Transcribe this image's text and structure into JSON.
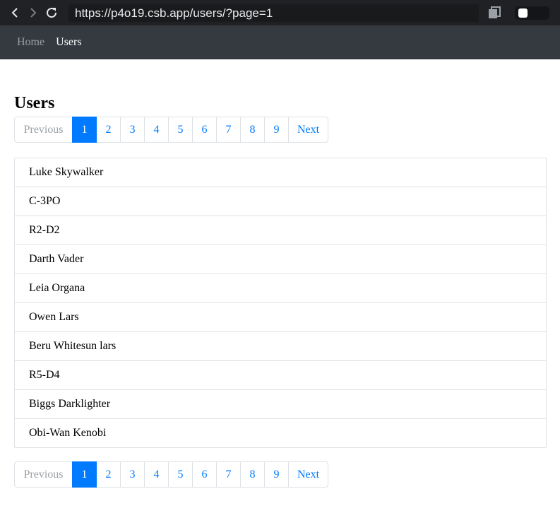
{
  "browser": {
    "url": "https://p4o19.csb.app/users/?page=1"
  },
  "navbar": {
    "items": [
      {
        "label": "Home",
        "active": false
      },
      {
        "label": "Users",
        "active": true
      }
    ]
  },
  "page": {
    "title": "Users"
  },
  "pagination": {
    "previous_label": "Previous",
    "next_label": "Next",
    "pages": [
      "1",
      "2",
      "3",
      "4",
      "5",
      "6",
      "7",
      "8",
      "9"
    ],
    "current_page": "1"
  },
  "users": [
    "Luke Skywalker",
    "C-3PO",
    "R2-D2",
    "Darth Vader",
    "Leia Organa",
    "Owen Lars",
    "Beru Whitesun lars",
    "R5-D4",
    "Biggs Darklighter",
    "Obi-Wan Kenobi"
  ],
  "colors": {
    "primary": "#007bff",
    "navbar_bg": "#343a40",
    "browser_bg": "#202124"
  }
}
